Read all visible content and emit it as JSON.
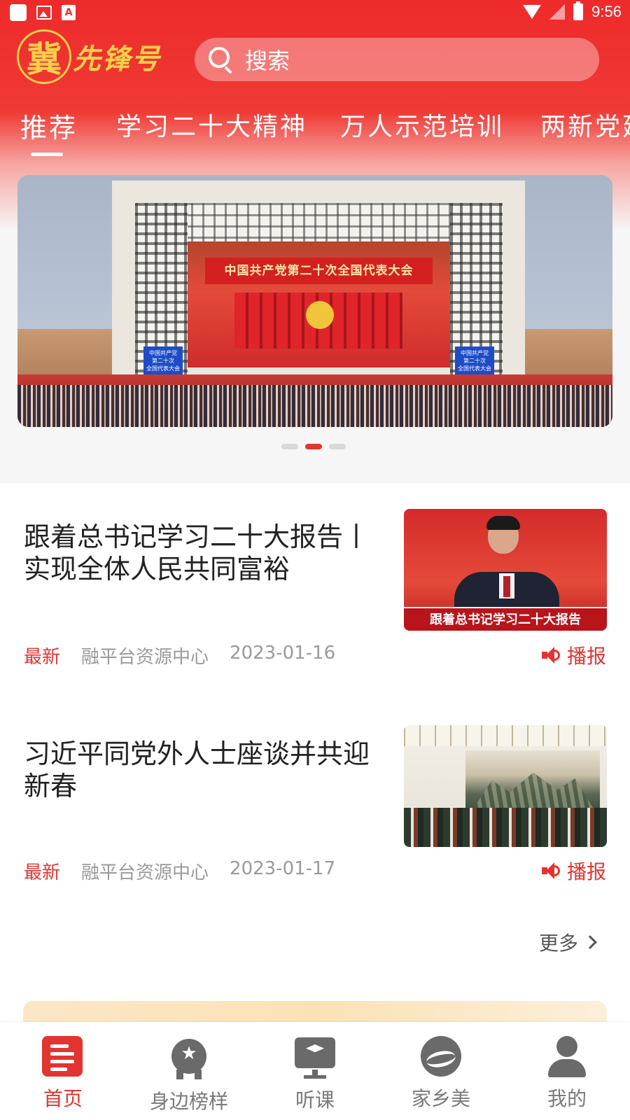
{
  "status_bar": {
    "time": "9:56"
  },
  "header": {
    "logo": {
      "char": "冀",
      "text": "先锋号"
    },
    "search": {
      "placeholder": "搜索"
    },
    "tabs": [
      {
        "label": "推荐",
        "active": true
      },
      {
        "label": "学习二十大精神",
        "active": false
      },
      {
        "label": "万人示范培训",
        "active": false
      },
      {
        "label": "两新党建",
        "active": false
      }
    ]
  },
  "banner": {
    "stage_text": "中国共产党第二十次全国代表大会",
    "sign_text": "中国共产党\n第二十次\n全国代表大会",
    "pages": 3,
    "active_page": 2
  },
  "news": [
    {
      "title": "跟着总书记学习二十大报告丨实现全体人民共同富裕",
      "tag": "最新",
      "source": "融平台资源中心",
      "date": "2023-01-16",
      "broadcast": "播报",
      "thumb_caption": "跟着总书记学习二十大报告"
    },
    {
      "title": "习近平同党外人士座谈并共迎新春",
      "tag": "最新",
      "source": "融平台资源中心",
      "date": "2023-01-17",
      "broadcast": "播报"
    }
  ],
  "more_label": "更多",
  "bottom_nav": [
    {
      "label": "首页",
      "icon": "home-doc-icon",
      "active": true
    },
    {
      "label": "身边榜样",
      "icon": "badge-icon",
      "active": false
    },
    {
      "label": "听课",
      "icon": "classroom-icon",
      "active": false
    },
    {
      "label": "家乡美",
      "icon": "hometown-icon",
      "active": false
    },
    {
      "label": "我的",
      "icon": "user-icon",
      "active": false
    }
  ],
  "colors": {
    "primary": "#e33430",
    "header_red": "#ee2a2a",
    "logo_gold": "#f5d04a"
  }
}
